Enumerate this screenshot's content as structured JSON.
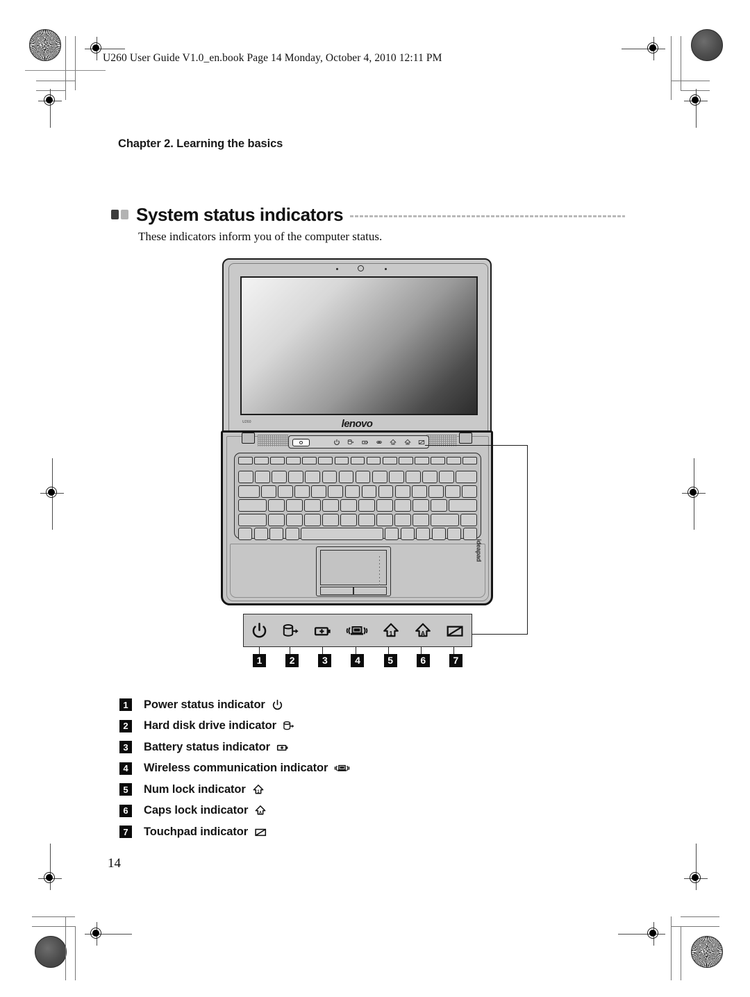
{
  "document": {
    "header_line": "U260 User Guide V1.0_en.book  Page 14  Monday, October 4, 2010  12:11 PM",
    "chapter_title": "Chapter 2. Learning the basics",
    "section_title": "System status indicators",
    "intro_text": "These indicators inform you of the computer status.",
    "page_number": "14"
  },
  "illustration": {
    "screen_logo": "lenovo",
    "model_label": "U260",
    "brand_label": "ideapad"
  },
  "callout": {
    "numbers": [
      "1",
      "2",
      "3",
      "4",
      "5",
      "6",
      "7"
    ],
    "icon_names": [
      "power-icon",
      "hard-disk-icon",
      "battery-icon",
      "wireless-icon",
      "num-lock-icon",
      "caps-lock-icon",
      "touchpad-icon"
    ]
  },
  "legend": {
    "items": [
      {
        "num": "1",
        "label": "Power status indicator",
        "icon": "power-icon"
      },
      {
        "num": "2",
        "label": "Hard disk drive indicator",
        "icon": "hard-disk-icon"
      },
      {
        "num": "3",
        "label": "Battery status indicator",
        "icon": "battery-icon"
      },
      {
        "num": "4",
        "label": "Wireless communication indicator",
        "icon": "wireless-icon"
      },
      {
        "num": "5",
        "label": "Num lock indicator",
        "icon": "num-lock-icon"
      },
      {
        "num": "6",
        "label": "Caps lock indicator",
        "icon": "caps-lock-icon"
      },
      {
        "num": "7",
        "label": "Touchpad indicator",
        "icon": "touchpad-icon"
      }
    ]
  },
  "colors": {
    "ink": "#111111",
    "panel_gray": "#c9c9c9",
    "marker_black": "#0b0b0b",
    "rule_gray": "#b9b9b9"
  }
}
